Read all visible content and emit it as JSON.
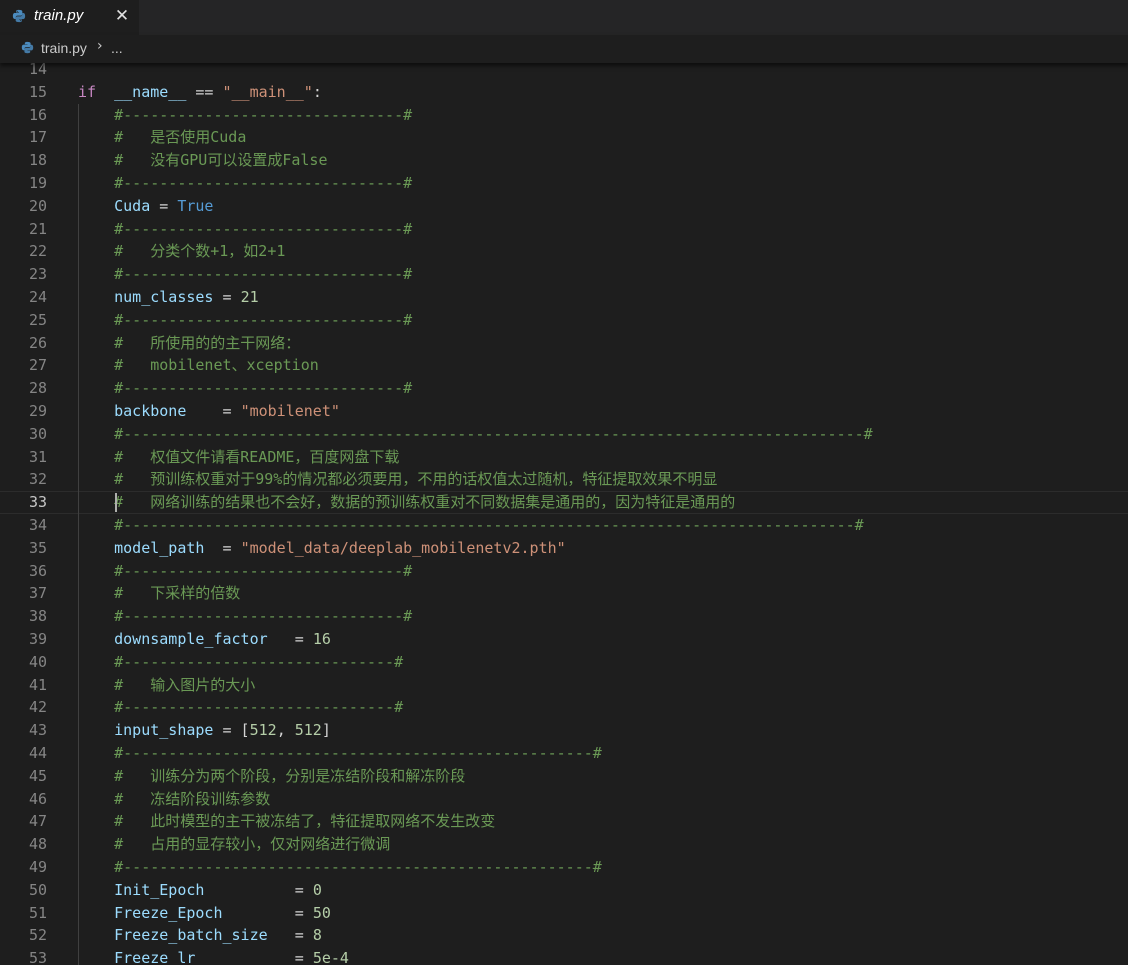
{
  "tab": {
    "title": "train.py",
    "close_glyph": "✕",
    "icon": "python-icon"
  },
  "breadcrumb": {
    "file": "train.py",
    "separator": "›",
    "more": "..."
  },
  "editor": {
    "first_line": 14,
    "current_line": 33,
    "lines": [
      {
        "n": 14,
        "indent": "",
        "tokens": []
      },
      {
        "n": 15,
        "indent": "",
        "tokens": [
          [
            "kw",
            "if"
          ],
          [
            "",
            "  "
          ],
          [
            "var",
            "__name__"
          ],
          [
            "",
            " == "
          ],
          [
            "str",
            "\"__main__\""
          ],
          [
            "",
            ":"
          ]
        ]
      },
      {
        "n": 16,
        "indent": "    ",
        "tokens": [
          [
            "cmt",
            "#-------------------------------#"
          ]
        ]
      },
      {
        "n": 17,
        "indent": "    ",
        "tokens": [
          [
            "cmt",
            "#   是否使用Cuda"
          ]
        ]
      },
      {
        "n": 18,
        "indent": "    ",
        "tokens": [
          [
            "cmt",
            "#   没有GPU可以设置成False"
          ]
        ]
      },
      {
        "n": 19,
        "indent": "    ",
        "tokens": [
          [
            "cmt",
            "#-------------------------------#"
          ]
        ]
      },
      {
        "n": 20,
        "indent": "    ",
        "tokens": [
          [
            "var",
            "Cuda"
          ],
          [
            "",
            " = "
          ],
          [
            "con",
            "True"
          ]
        ]
      },
      {
        "n": 21,
        "indent": "    ",
        "tokens": [
          [
            "cmt",
            "#-------------------------------#"
          ]
        ]
      },
      {
        "n": 22,
        "indent": "    ",
        "tokens": [
          [
            "cmt",
            "#   分类个数+1，如2+1"
          ]
        ]
      },
      {
        "n": 23,
        "indent": "    ",
        "tokens": [
          [
            "cmt",
            "#-------------------------------#"
          ]
        ]
      },
      {
        "n": 24,
        "indent": "    ",
        "tokens": [
          [
            "var",
            "num_classes"
          ],
          [
            "",
            " = "
          ],
          [
            "num",
            "21"
          ]
        ]
      },
      {
        "n": 25,
        "indent": "    ",
        "tokens": [
          [
            "cmt",
            "#-------------------------------#"
          ]
        ]
      },
      {
        "n": 26,
        "indent": "    ",
        "tokens": [
          [
            "cmt",
            "#   所使用的的主干网络："
          ]
        ]
      },
      {
        "n": 27,
        "indent": "    ",
        "tokens": [
          [
            "cmt",
            "#   mobilenet、xception"
          ]
        ]
      },
      {
        "n": 28,
        "indent": "    ",
        "tokens": [
          [
            "cmt",
            "#-------------------------------#"
          ]
        ]
      },
      {
        "n": 29,
        "indent": "    ",
        "tokens": [
          [
            "var",
            "backbone"
          ],
          [
            "",
            "    = "
          ],
          [
            "str",
            "\"mobilenet\""
          ]
        ]
      },
      {
        "n": 30,
        "indent": "    ",
        "tokens": [
          [
            "cmt",
            "#----------------------------------------------------------------------------------#"
          ]
        ]
      },
      {
        "n": 31,
        "indent": "    ",
        "tokens": [
          [
            "cmt",
            "#   权值文件请看README，百度网盘下载"
          ]
        ]
      },
      {
        "n": 32,
        "indent": "    ",
        "tokens": [
          [
            "cmt",
            "#   预训练权重对于99%的情况都必须要用，不用的话权值太过随机，特征提取效果不明显"
          ]
        ]
      },
      {
        "n": 33,
        "indent": "    ",
        "tokens": [
          [
            "cmt",
            "#   网络训练的结果也不会好，数据的预训练权重对不同数据集是通用的，因为特征是通用的"
          ]
        ]
      },
      {
        "n": 34,
        "indent": "    ",
        "tokens": [
          [
            "cmt",
            "#---------------------------------------------------------------------------------#"
          ]
        ]
      },
      {
        "n": 35,
        "indent": "    ",
        "tokens": [
          [
            "var",
            "model_path"
          ],
          [
            "",
            "  = "
          ],
          [
            "str",
            "\"model_data/deeplab_mobilenetv2.pth\""
          ]
        ]
      },
      {
        "n": 36,
        "indent": "    ",
        "tokens": [
          [
            "cmt",
            "#-------------------------------#"
          ]
        ]
      },
      {
        "n": 37,
        "indent": "    ",
        "tokens": [
          [
            "cmt",
            "#   下采样的倍数"
          ]
        ]
      },
      {
        "n": 38,
        "indent": "    ",
        "tokens": [
          [
            "cmt",
            "#-------------------------------#"
          ]
        ]
      },
      {
        "n": 39,
        "indent": "    ",
        "tokens": [
          [
            "var",
            "downsample_factor"
          ],
          [
            "",
            "   = "
          ],
          [
            "num",
            "16"
          ]
        ]
      },
      {
        "n": 40,
        "indent": "    ",
        "tokens": [
          [
            "cmt",
            "#------------------------------#"
          ]
        ]
      },
      {
        "n": 41,
        "indent": "    ",
        "tokens": [
          [
            "cmt",
            "#   输入图片的大小"
          ]
        ]
      },
      {
        "n": 42,
        "indent": "    ",
        "tokens": [
          [
            "cmt",
            "#------------------------------#"
          ]
        ]
      },
      {
        "n": 43,
        "indent": "    ",
        "tokens": [
          [
            "var",
            "input_shape"
          ],
          [
            "",
            " = ["
          ],
          [
            "num",
            "512"
          ],
          [
            "",
            ", "
          ],
          [
            "num",
            "512"
          ],
          [
            "",
            "]"
          ]
        ]
      },
      {
        "n": 44,
        "indent": "    ",
        "tokens": [
          [
            "cmt",
            "#----------------------------------------------------#"
          ]
        ]
      },
      {
        "n": 45,
        "indent": "    ",
        "tokens": [
          [
            "cmt",
            "#   训练分为两个阶段，分别是冻结阶段和解冻阶段"
          ]
        ]
      },
      {
        "n": 46,
        "indent": "    ",
        "tokens": [
          [
            "cmt",
            "#   冻结阶段训练参数"
          ]
        ]
      },
      {
        "n": 47,
        "indent": "    ",
        "tokens": [
          [
            "cmt",
            "#   此时模型的主干被冻结了，特征提取网络不发生改变"
          ]
        ]
      },
      {
        "n": 48,
        "indent": "    ",
        "tokens": [
          [
            "cmt",
            "#   占用的显存较小，仅对网络进行微调"
          ]
        ]
      },
      {
        "n": 49,
        "indent": "    ",
        "tokens": [
          [
            "cmt",
            "#----------------------------------------------------#"
          ]
        ]
      },
      {
        "n": 50,
        "indent": "    ",
        "tokens": [
          [
            "var",
            "Init_Epoch"
          ],
          [
            "",
            "          = "
          ],
          [
            "num",
            "0"
          ]
        ]
      },
      {
        "n": 51,
        "indent": "    ",
        "tokens": [
          [
            "var",
            "Freeze_Epoch"
          ],
          [
            "",
            "        = "
          ],
          [
            "num",
            "50"
          ]
        ]
      },
      {
        "n": 52,
        "indent": "    ",
        "tokens": [
          [
            "var",
            "Freeze_batch_size"
          ],
          [
            "",
            "   = "
          ],
          [
            "num",
            "8"
          ]
        ]
      },
      {
        "n": 53,
        "indent": "    ",
        "tokens": [
          [
            "var",
            "Freeze_lr"
          ],
          [
            "",
            "           = "
          ],
          [
            "num",
            "5e-4"
          ]
        ]
      }
    ]
  },
  "colors": {
    "background": "#1e1e1e",
    "keyword": "#c586c0",
    "variable": "#9cdcfe",
    "string": "#ce9178",
    "number": "#b5cea8",
    "comment": "#6a9955",
    "constant": "#569cd6"
  }
}
